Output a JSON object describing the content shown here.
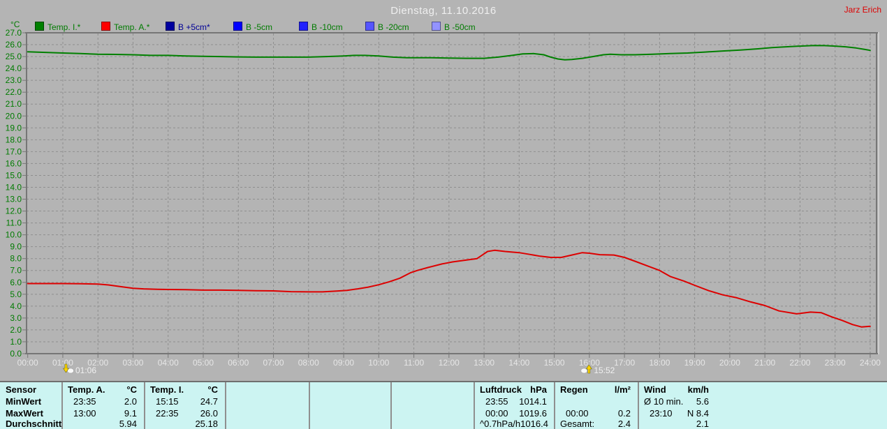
{
  "header": {
    "title": "Dienstag, 11.10.2016",
    "user": "Jarz Erich"
  },
  "legend": {
    "items": [
      {
        "label": "Temp. I.*",
        "swatch_color": "#008000",
        "label_color": "#007b00"
      },
      {
        "label": "Temp. A.*",
        "swatch_color": "#ff0000",
        "label_color": "#007b00"
      },
      {
        "label": "B +5cm*",
        "swatch_color": "#0000a0",
        "label_color": "#000096"
      },
      {
        "label": "B -5cm",
        "swatch_color": "#0000ff",
        "label_color": "#007b00"
      },
      {
        "label": "B -10cm",
        "swatch_color": "#2222ff",
        "label_color": "#007b00"
      },
      {
        "label": "B -20cm",
        "swatch_color": "#5555ff",
        "label_color": "#007b00"
      },
      {
        "label": "B -50cm",
        "swatch_color": "#9393ff",
        "label_color": "#007b00"
      }
    ]
  },
  "chart_data": {
    "type": "line",
    "title": "Dienstag, 11.10.2016",
    "xlabel": "",
    "ylabel": "°C",
    "ylim": [
      0,
      27
    ],
    "y_tick_step": 1.0,
    "xlim_hours": [
      0,
      24
    ],
    "grid": true,
    "legend_position": "top",
    "x_tick_labels": [
      "00:00",
      "01:00",
      "02:00",
      "03:00",
      "04:00",
      "05:00",
      "06:00",
      "07:00",
      "08:00",
      "09:00",
      "10:00",
      "11:00",
      "12:00",
      "13:00",
      "14:00",
      "15:00",
      "16:00",
      "17:00",
      "18:00",
      "19:00",
      "20:00",
      "21:00",
      "22:00",
      "23:00",
      "24:00"
    ],
    "series": [
      {
        "name": "Temp. I.",
        "color": "#008000",
        "points": [
          [
            0,
            25.4
          ],
          [
            0.5,
            25.35
          ],
          [
            1,
            25.3
          ],
          [
            1.5,
            25.25
          ],
          [
            2,
            25.2
          ],
          [
            2.5,
            25.18
          ],
          [
            3,
            25.15
          ],
          [
            3.5,
            25.1
          ],
          [
            4,
            25.1
          ],
          [
            4.5,
            25.05
          ],
          [
            5,
            25.02
          ],
          [
            5.5,
            25.0
          ],
          [
            6,
            24.97
          ],
          [
            6.5,
            24.95
          ],
          [
            7,
            24.95
          ],
          [
            7.5,
            24.95
          ],
          [
            8,
            24.95
          ],
          [
            8.5,
            25.0
          ],
          [
            9,
            25.05
          ],
          [
            9.3,
            25.1
          ],
          [
            9.6,
            25.1
          ],
          [
            10,
            25.05
          ],
          [
            10.4,
            24.95
          ],
          [
            10.8,
            24.9
          ],
          [
            11.5,
            24.9
          ],
          [
            12,
            24.87
          ],
          [
            12.5,
            24.85
          ],
          [
            13,
            24.85
          ],
          [
            13.4,
            24.95
          ],
          [
            13.8,
            25.1
          ],
          [
            14.1,
            25.22
          ],
          [
            14.4,
            25.25
          ],
          [
            14.7,
            25.15
          ],
          [
            14.9,
            24.95
          ],
          [
            15.1,
            24.8
          ],
          [
            15.3,
            24.72
          ],
          [
            15.5,
            24.75
          ],
          [
            15.8,
            24.85
          ],
          [
            16.1,
            25.0
          ],
          [
            16.4,
            25.15
          ],
          [
            16.6,
            25.2
          ],
          [
            16.9,
            25.15
          ],
          [
            17.3,
            25.15
          ],
          [
            17.8,
            25.2
          ],
          [
            18.3,
            25.25
          ],
          [
            18.8,
            25.3
          ],
          [
            19.3,
            25.38
          ],
          [
            19.8,
            25.47
          ],
          [
            20.3,
            25.55
          ],
          [
            20.8,
            25.65
          ],
          [
            21.2,
            25.75
          ],
          [
            21.6,
            25.82
          ],
          [
            22,
            25.88
          ],
          [
            22.4,
            25.93
          ],
          [
            22.7,
            25.92
          ],
          [
            23,
            25.88
          ],
          [
            23.3,
            25.82
          ],
          [
            23.6,
            25.72
          ],
          [
            23.85,
            25.6
          ],
          [
            24,
            25.52
          ]
        ]
      },
      {
        "name": "Temp. A.",
        "color": "#dd0000",
        "points": [
          [
            0,
            5.9
          ],
          [
            0.5,
            5.9
          ],
          [
            1,
            5.9
          ],
          [
            1.5,
            5.88
          ],
          [
            2,
            5.85
          ],
          [
            2.3,
            5.78
          ],
          [
            2.7,
            5.62
          ],
          [
            3,
            5.5
          ],
          [
            3.3,
            5.45
          ],
          [
            3.7,
            5.42
          ],
          [
            4,
            5.4
          ],
          [
            4.5,
            5.38
          ],
          [
            5,
            5.35
          ],
          [
            5.5,
            5.35
          ],
          [
            6,
            5.33
          ],
          [
            6.5,
            5.3
          ],
          [
            7,
            5.28
          ],
          [
            7.5,
            5.22
          ],
          [
            8,
            5.2
          ],
          [
            8.4,
            5.2
          ],
          [
            8.8,
            5.27
          ],
          [
            9.1,
            5.33
          ],
          [
            9.4,
            5.45
          ],
          [
            9.7,
            5.6
          ],
          [
            10,
            5.8
          ],
          [
            10.3,
            6.05
          ],
          [
            10.6,
            6.35
          ],
          [
            10.9,
            6.8
          ],
          [
            11.1,
            7.0
          ],
          [
            11.4,
            7.25
          ],
          [
            11.8,
            7.55
          ],
          [
            12.1,
            7.72
          ],
          [
            12.5,
            7.88
          ],
          [
            12.8,
            8.0
          ],
          [
            12.95,
            8.3
          ],
          [
            13.1,
            8.6
          ],
          [
            13.3,
            8.7
          ],
          [
            13.6,
            8.6
          ],
          [
            14,
            8.5
          ],
          [
            14.3,
            8.35
          ],
          [
            14.6,
            8.2
          ],
          [
            14.9,
            8.1
          ],
          [
            15.2,
            8.1
          ],
          [
            15.5,
            8.3
          ],
          [
            15.8,
            8.5
          ],
          [
            16,
            8.45
          ],
          [
            16.3,
            8.33
          ],
          [
            16.7,
            8.3
          ],
          [
            17,
            8.1
          ],
          [
            17.3,
            7.78
          ],
          [
            17.7,
            7.33
          ],
          [
            18,
            7.0
          ],
          [
            18.3,
            6.5
          ],
          [
            18.7,
            6.1
          ],
          [
            19,
            5.75
          ],
          [
            19.4,
            5.3
          ],
          [
            19.8,
            4.95
          ],
          [
            20.2,
            4.7
          ],
          [
            20.6,
            4.35
          ],
          [
            21,
            4.05
          ],
          [
            21.4,
            3.6
          ],
          [
            21.9,
            3.35
          ],
          [
            22.3,
            3.5
          ],
          [
            22.6,
            3.45
          ],
          [
            22.9,
            3.1
          ],
          [
            23.2,
            2.8
          ],
          [
            23.5,
            2.45
          ],
          [
            23.75,
            2.25
          ],
          [
            24,
            2.3
          ]
        ]
      }
    ],
    "time_markers": [
      {
        "label": "01:06",
        "hour": 1.1,
        "arrow": "down"
      },
      {
        "label": "15:52",
        "hour": 15.87,
        "arrow": "up"
      }
    ]
  },
  "summary_table": {
    "row_labels": [
      "Sensor",
      "MinWert",
      "MaxWert",
      "Durchschnitt"
    ],
    "columns": [
      {
        "name": "Temp. A.",
        "unit": "°C",
        "rows": [
          [
            "23:35",
            "2.0"
          ],
          [
            "13:00",
            "9.1"
          ],
          [
            "",
            "5.94"
          ]
        ]
      },
      {
        "name": "Temp. I.",
        "unit": "°C",
        "rows": [
          [
            "15:15",
            "24.7"
          ],
          [
            "22:35",
            "26.0"
          ],
          [
            "",
            "25.18"
          ]
        ]
      },
      {
        "name": "",
        "unit": "",
        "rows": [
          [
            "",
            ""
          ],
          [
            "",
            ""
          ],
          [
            "",
            ""
          ]
        ]
      },
      {
        "name": "",
        "unit": "",
        "rows": [
          [
            "",
            ""
          ],
          [
            "",
            ""
          ],
          [
            "",
            ""
          ]
        ]
      },
      {
        "name": "",
        "unit": "",
        "rows": [
          [
            "",
            ""
          ],
          [
            "",
            ""
          ],
          [
            "",
            ""
          ]
        ]
      },
      {
        "name": "Luftdruck",
        "unit": "hPa",
        "rows": [
          [
            "23:55",
            "1014.1"
          ],
          [
            "00:00",
            "1019.6"
          ],
          [
            "^0.7hPa/h",
            "1016.4"
          ]
        ]
      },
      {
        "name": "Regen",
        "unit": "l/m²",
        "rows": [
          [
            "",
            ""
          ],
          [
            "00:00",
            "0.2"
          ],
          [
            "Gesamt:",
            "2.4"
          ]
        ]
      },
      {
        "name": "Wind",
        "unit": "km/h",
        "rows": [
          [
            "Ø 10 min.",
            "5.6"
          ],
          [
            "23:10",
            "N 8.4"
          ],
          [
            "",
            "2.1"
          ]
        ]
      }
    ]
  }
}
